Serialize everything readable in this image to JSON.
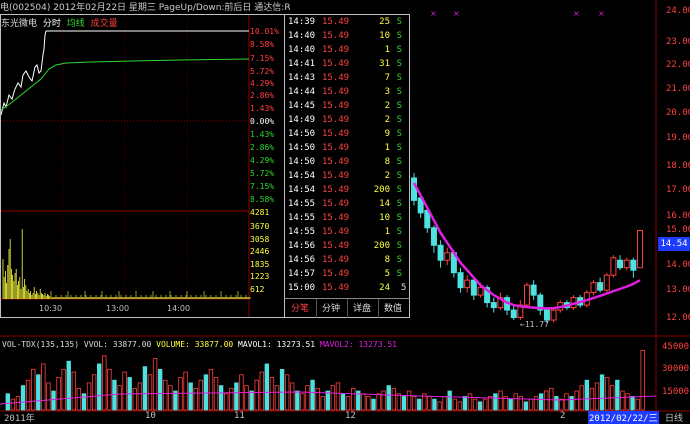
{
  "title": {
    "text": "电(002504) 2012年02月22日 星期三 PageUp/Down:前后日 通达信:R"
  },
  "popup": {
    "header": {
      "stock": "东光微电",
      "tab_time": "分时",
      "legend_avg": "均线",
      "legend_vol": "成交量"
    },
    "pct_labels": [
      "10.01%",
      "8.58%",
      "7.15%",
      "5.72%",
      "4.29%",
      "2.86%",
      "1.43%",
      "0.00%",
      "1.43%",
      "2.86%",
      "4.29%",
      "5.72%",
      "7.15%",
      "8.58%"
    ],
    "vol_labels": [
      "4281",
      "3670",
      "3058",
      "2446",
      "1835",
      "1223",
      "612"
    ],
    "time_labels": [
      "10:30",
      "13:00",
      "14:00"
    ],
    "ticks": [
      {
        "time": "14:39",
        "price": "15.49",
        "vol": "25",
        "flag": "S"
      },
      {
        "time": "14:40",
        "price": "15.49",
        "vol": "10",
        "flag": "S"
      },
      {
        "time": "14:40",
        "price": "15.49",
        "vol": "1",
        "flag": "S"
      },
      {
        "time": "14:41",
        "price": "15.49",
        "vol": "31",
        "flag": "S"
      },
      {
        "time": "14:43",
        "price": "15.49",
        "vol": "7",
        "flag": "S"
      },
      {
        "time": "14:44",
        "price": "15.49",
        "vol": "3",
        "flag": "S"
      },
      {
        "time": "14:45",
        "price": "15.49",
        "vol": "2",
        "flag": "S"
      },
      {
        "time": "14:49",
        "price": "15.49",
        "vol": "2",
        "flag": "S"
      },
      {
        "time": "14:50",
        "price": "15.49",
        "vol": "9",
        "flag": "S"
      },
      {
        "time": "14:50",
        "price": "15.49",
        "vol": "1",
        "flag": "S"
      },
      {
        "time": "14:50",
        "price": "15.49",
        "vol": "8",
        "flag": "S"
      },
      {
        "time": "14:54",
        "price": "15.49",
        "vol": "2",
        "flag": "S"
      },
      {
        "time": "14:54",
        "price": "15.49",
        "vol": "200",
        "flag": "S"
      },
      {
        "time": "14:55",
        "price": "15.49",
        "vol": "14",
        "flag": "S"
      },
      {
        "time": "14:55",
        "price": "15.49",
        "vol": "10",
        "flag": "S"
      },
      {
        "time": "14:55",
        "price": "15.49",
        "vol": "1",
        "flag": "S"
      },
      {
        "time": "14:56",
        "price": "15.49",
        "vol": "200",
        "flag": "S"
      },
      {
        "time": "14:56",
        "price": "15.49",
        "vol": "8",
        "flag": "S"
      },
      {
        "time": "14:57",
        "price": "15.49",
        "vol": "5",
        "flag": "S"
      },
      {
        "time": "15:00",
        "price": "15.49",
        "vol": "24",
        "flag": ""
      }
    ],
    "last_tick_extra": "5",
    "tabs": [
      "分笔",
      "分钟",
      "详盘",
      "数值"
    ]
  },
  "price_axis": {
    "labels": [
      "24.00",
      "23.00",
      "22.00",
      "21.00",
      "20.00",
      "19.00",
      "18.00",
      "17.00",
      "16.00",
      "15.00",
      "14.00",
      "13.00",
      "12.00"
    ],
    "current": "14.54",
    "low_annotation": "←11.77"
  },
  "volume_pane": {
    "label": "VOL-TDX(135,135)",
    "vvol": "VVOL: 33877.00",
    "volume": "VOLUME: 33877.00",
    "mavol1": "MAVOL1: 13273.51",
    "mavol2": "MAVOL2: 13273.51",
    "axis": [
      "45000",
      "30000",
      "15000"
    ]
  },
  "date_axis": {
    "labels": [
      "2011年",
      "10",
      "11",
      "12",
      "2",
      "2012/02/22/三",
      "日线"
    ]
  },
  "colors": {
    "up": "#ff4040",
    "down": "#4fe0e0",
    "ma": "#e020e0",
    "price_line": "#ffffff",
    "avg_line": "#31d631"
  },
  "chart_data": {
    "type": "candlestick",
    "visible_candles": [
      {
        "o": 17.6,
        "c": 16.7,
        "h": 17.8,
        "l": 16.5
      },
      {
        "o": 16.8,
        "c": 16.2,
        "h": 17.0,
        "l": 16.0
      },
      {
        "o": 16.3,
        "c": 15.6,
        "h": 16.4,
        "l": 15.4
      },
      {
        "o": 15.6,
        "c": 14.9,
        "h": 15.7,
        "l": 14.6
      },
      {
        "o": 14.9,
        "c": 14.3,
        "h": 15.1,
        "l": 14.0
      },
      {
        "o": 14.3,
        "c": 14.6,
        "h": 14.8,
        "l": 14.1
      },
      {
        "o": 14.6,
        "c": 13.8,
        "h": 14.7,
        "l": 13.6
      },
      {
        "o": 13.8,
        "c": 13.2,
        "h": 14.0,
        "l": 13.0
      },
      {
        "o": 13.2,
        "c": 13.5,
        "h": 13.7,
        "l": 13.0
      },
      {
        "o": 13.5,
        "c": 12.9,
        "h": 13.6,
        "l": 12.7
      },
      {
        "o": 12.9,
        "c": 13.2,
        "h": 13.4,
        "l": 12.8
      },
      {
        "o": 13.2,
        "c": 12.6,
        "h": 13.3,
        "l": 12.4
      },
      {
        "o": 12.6,
        "c": 12.4,
        "h": 12.8,
        "l": 12.2
      },
      {
        "o": 12.4,
        "c": 12.8,
        "h": 13.0,
        "l": 12.3
      },
      {
        "o": 12.8,
        "c": 12.3,
        "h": 12.9,
        "l": 12.1
      },
      {
        "o": 12.3,
        "c": 12.0,
        "h": 12.5,
        "l": 11.9
      },
      {
        "o": 12.0,
        "c": 12.5,
        "h": 12.7,
        "l": 11.9
      },
      {
        "o": 12.5,
        "c": 13.3,
        "h": 13.4,
        "l": 12.4
      },
      {
        "o": 13.3,
        "c": 12.9,
        "h": 13.5,
        "l": 12.7
      },
      {
        "o": 12.9,
        "c": 12.3,
        "h": 13.0,
        "l": 12.1
      },
      {
        "o": 12.3,
        "c": 11.9,
        "h": 12.4,
        "l": 11.77
      },
      {
        "o": 11.9,
        "c": 12.3,
        "h": 12.4,
        "l": 11.8
      },
      {
        "o": 12.3,
        "c": 12.6,
        "h": 12.7,
        "l": 12.2
      },
      {
        "o": 12.6,
        "c": 12.4,
        "h": 12.7,
        "l": 12.3
      },
      {
        "o": 12.4,
        "c": 12.8,
        "h": 12.9,
        "l": 12.3
      },
      {
        "o": 12.8,
        "c": 12.5,
        "h": 12.9,
        "l": 12.4
      },
      {
        "o": 12.5,
        "c": 13.0,
        "h": 13.1,
        "l": 12.4
      },
      {
        "o": 13.0,
        "c": 13.4,
        "h": 13.5,
        "l": 12.9
      },
      {
        "o": 13.4,
        "c": 13.1,
        "h": 13.6,
        "l": 13.0
      },
      {
        "o": 13.1,
        "c": 13.7,
        "h": 13.8,
        "l": 13.0
      },
      {
        "o": 13.7,
        "c": 14.4,
        "h": 14.5,
        "l": 13.6
      },
      {
        "o": 14.3,
        "c": 14.0,
        "h": 14.5,
        "l": 13.9
      },
      {
        "o": 14.0,
        "c": 14.3,
        "h": 14.4,
        "l": 13.9
      },
      {
        "o": 14.3,
        "c": 13.9,
        "h": 14.4,
        "l": 13.6
      },
      {
        "o": 14.0,
        "c": 15.49,
        "h": 15.49,
        "l": 14.0
      }
    ],
    "ma": [
      17.4,
      16.9,
      16.4,
      15.9,
      15.4,
      15.0,
      14.6,
      14.2,
      13.9,
      13.6,
      13.3,
      13.1,
      12.9,
      12.75,
      12.6,
      12.5,
      12.45,
      12.42,
      12.4,
      12.38,
      12.37,
      12.38,
      12.42,
      12.48,
      12.55,
      12.62,
      12.7,
      12.78,
      12.87,
      12.96,
      13.06,
      13.15,
      13.24,
      13.35,
      13.5
    ],
    "ylim": [
      11.5,
      24.5
    ]
  }
}
